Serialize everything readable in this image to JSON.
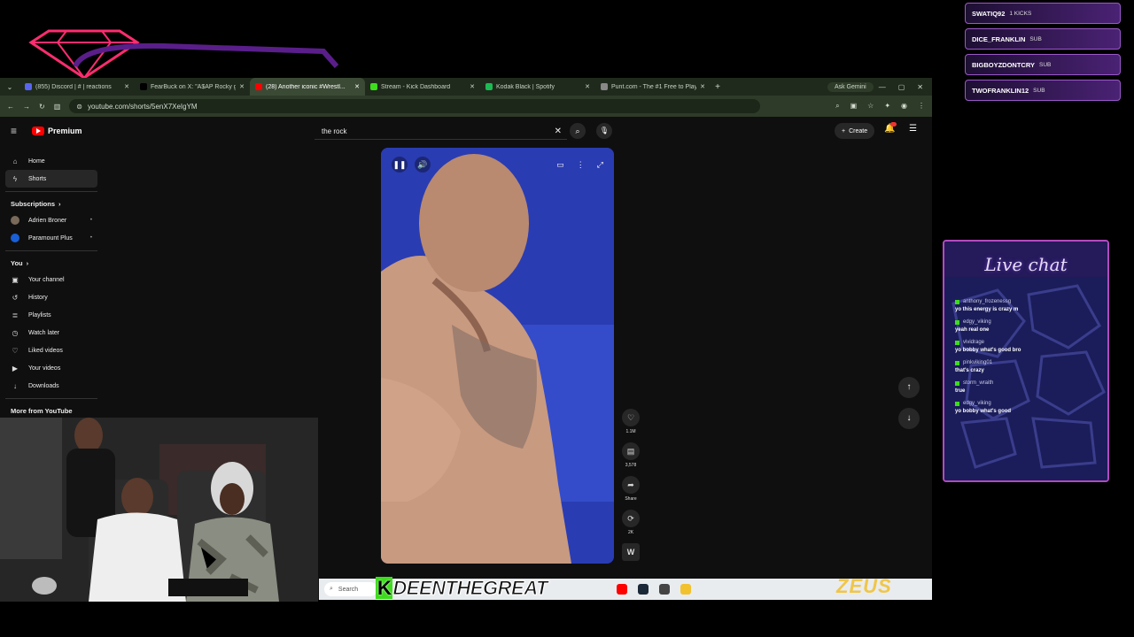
{
  "browser": {
    "tabs": [
      {
        "label": "(855) Discord | #‌ | reactions",
        "favicon": "#5865f2",
        "active": false
      },
      {
        "label": "FearBuck on X: \"A$AP Rocky g...",
        "favicon": "#000000",
        "active": false
      },
      {
        "label": "(28) Another iconic #Wrestl...",
        "favicon": "#ff0000",
        "active": true
      },
      {
        "label": "Stream - Kick Dashboard",
        "favicon": "#3ddc1c",
        "active": false
      },
      {
        "label": "Kodak Black | Spotify",
        "favicon": "#1db954",
        "active": false
      },
      {
        "label": "Punt.com - The #1 Free to Play",
        "favicon": "#888888",
        "active": false
      }
    ],
    "ask_label": "Ask Gemini",
    "url": "youtube.com/shorts/5enX7XeIgYM"
  },
  "youtube": {
    "brand": "Premium",
    "search_value": "the rock",
    "create_label": "Create",
    "sidebar": {
      "main": [
        {
          "label": "Home",
          "icon": "home-icon",
          "glyph": "⌂"
        },
        {
          "label": "Shorts",
          "icon": "shorts-icon",
          "glyph": "ϟ"
        }
      ],
      "subscriptions_title": "Subscriptions",
      "subscriptions": [
        {
          "label": "Adrien Broner",
          "color": "#7a6a5a"
        },
        {
          "label": "Paramount Plus",
          "color": "#1a5fd6"
        }
      ],
      "you_title": "You",
      "you": [
        {
          "label": "Your channel",
          "icon": "channel-icon",
          "glyph": "▣"
        },
        {
          "label": "History",
          "icon": "history-icon",
          "glyph": "↺"
        },
        {
          "label": "Playlists",
          "icon": "playlists-icon",
          "glyph": "≣"
        },
        {
          "label": "Watch later",
          "icon": "watch-later-icon",
          "glyph": "◷"
        },
        {
          "label": "Liked videos",
          "icon": "liked-icon",
          "glyph": "♡"
        },
        {
          "label": "Your videos",
          "icon": "your-videos-icon",
          "glyph": "▶"
        },
        {
          "label": "Downloads",
          "icon": "downloads-icon",
          "glyph": "↓"
        }
      ],
      "more_title": "More from YouTube"
    },
    "short": {
      "likes": "1.1M",
      "comments": "3,578",
      "share_label": "Share",
      "remix": "2K"
    }
  },
  "taskbar": {
    "search_label": "Search"
  },
  "overlay": {
    "streamer": "DEENTHEGREAT",
    "sponsor": "ZEUS",
    "alerts": [
      {
        "name": "SWATIQ92",
        "kind": "1 KICKS"
      },
      {
        "name": "DICE_FRANKLIN",
        "kind": "SUB"
      },
      {
        "name": "BIGBOYZDONTCRY",
        "kind": "SUB"
      },
      {
        "name": "TWOFRANKLIN12",
        "kind": "SUB"
      }
    ],
    "chat_title": "Live chat",
    "messages": [
      {
        "user": "anthony_frozenessg",
        "text": "yo this energy is crazy m"
      },
      {
        "user": "edgy_viking",
        "text": "yeah real one"
      },
      {
        "user": "vividrage",
        "text": "yo bobby what's good bro"
      },
      {
        "user": "pinkviking01",
        "text": "that's crazy"
      },
      {
        "user": "storm_wraith",
        "text": "true"
      },
      {
        "user": "edgy_viking",
        "text": "yo bobby what's good"
      }
    ]
  }
}
